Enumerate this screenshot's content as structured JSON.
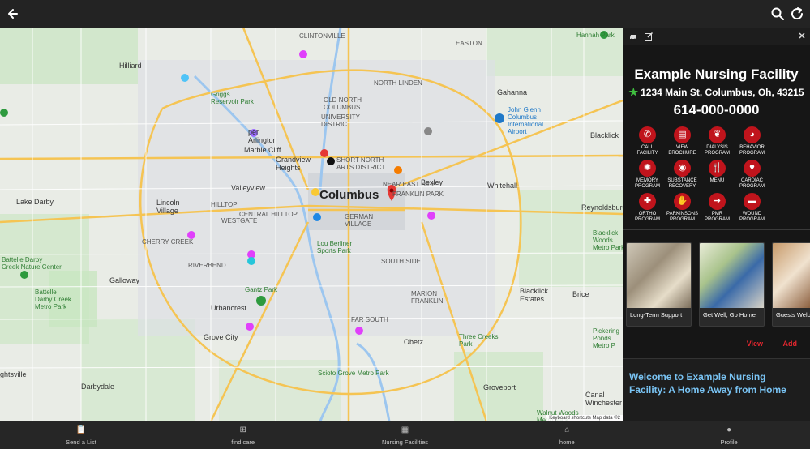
{
  "topbar": {
    "back_icon": "back-arrow-icon",
    "search_icon": "search-icon",
    "refresh_icon": "refresh-icon"
  },
  "map": {
    "labels": {
      "columbus": "Columbus",
      "hilliard": "Hilliard",
      "lake_darby": "Lake Darby",
      "galloway": "Galloway",
      "urbancrest": "Urbancrest",
      "grove_city": "Grove City",
      "darbydale": "Darbydale",
      "valleyview": "Valleyview",
      "lincoln_village": "Lincoln\nVillage",
      "marble_cliff": "Marble Cliff",
      "grandview": "Grandview\nHeights",
      "upper_arlington": "per\nArlington",
      "bexley": "Bexley",
      "whitehall": "Whitehall",
      "reynoldsburg": "Reynoldsburg",
      "blacklick": "Blacklick",
      "gahanna": "Gahanna",
      "obetz": "Obetz",
      "groveport": "Groveport",
      "brice": "Brice",
      "canal_winchester": "Canal\nWinchester",
      "blacklick_estates": "Blacklick\nEstates",
      "clintonville": "CLINTONVILLE",
      "easton": "EASTON",
      "north_linden": "NORTH LINDEN",
      "old_north": "OLD NORTH\nCOLUMBUS",
      "university": "UNIVERSITY\nDISTRICT",
      "short_north": "SHORT NORTH\nARTS DISTRICT",
      "near_east": "NEAR EAST SIDE",
      "franklin_park": "FRANKLIN PARK",
      "german_village": "GERMAN\nVILLAGE",
      "hilltop": "HILLTOP",
      "westgate": "WESTGATE",
      "central_hilltop": "CENTRAL HILLTOP",
      "cherry_creek": "CHERRY CREEK",
      "riverbend": "RIVERBEND",
      "far_south": "FAR SOUTH",
      "marion_franklin": "MARION\nFRANKLIN",
      "south_side": "SOUTH SIDE",
      "hannah_park": "Hannah Park",
      "john_glenn": "John Glenn\nColumbus\nInternational\nAirport",
      "griggs": "Griggs\nReservoir Park",
      "lou_berliner": "Lou Berliner\nSports Park",
      "gantz_park": "Gantz Park",
      "scioto_grove": "Scioto Grove Metro Park",
      "three_creeks": "Three Creeks\nPark",
      "battelle_nature": "Battelle Darby\nCreek Nature Center",
      "battelle_metro": "Battelle\nDarby Creek\nMetro Park",
      "blacklick_woods": "Blacklick\nWoods\nMetro Park",
      "walnut_woods": "Walnut Woods\nMetro Park",
      "pickerington": "Pickering\nPonds\nMetro P",
      "sightsville": "ghtsville"
    },
    "attribution": "Keyboard shortcuts   Map data ©2"
  },
  "panel": {
    "car_icon": "car-icon",
    "edit_icon": "edit-icon",
    "close_icon": "close-icon",
    "facility_name": "Example Nursing Facility",
    "address": "1234 Main St, Columbus, Oh, 43215",
    "phone": "614-000-0000",
    "actions": [
      {
        "label": "CALL\nFACILITY",
        "icon": "phone-icon"
      },
      {
        "label": "VIEW\nBROCHURE",
        "icon": "brochure-icon"
      },
      {
        "label": "DIALYSIS\nPROGRAM",
        "icon": "kidney-icon"
      },
      {
        "label": "BEHAVIOR\nPROGRAM",
        "icon": "head-icon"
      },
      {
        "label": "MEMORY\nPROGRAM",
        "icon": "memory-icon"
      },
      {
        "label": "SUBSTANCE\nRECOVERY",
        "icon": "recovery-icon"
      },
      {
        "label": "MENU",
        "icon": "utensils-icon"
      },
      {
        "label": "CARDIAC\nPROGRAM",
        "icon": "heart-icon"
      },
      {
        "label": "ORTHO\nPROGRAM",
        "icon": "bone-icon"
      },
      {
        "label": "PARKINSONS\nPROGRAM",
        "icon": "hand-icon"
      },
      {
        "label": "PMR\nPROGRAM",
        "icon": "walking-icon"
      },
      {
        "label": "WOUND\nPROGRAM",
        "icon": "bandage-icon"
      }
    ],
    "cards": [
      {
        "caption": "Long-Term Support"
      },
      {
        "caption": "Get Well, Go Home"
      },
      {
        "caption": "Guests Welc"
      }
    ],
    "view_label": "View",
    "add_label": "Add",
    "welcome_title": "Welcome to Example Nursing Facility: A Home Away from Home"
  },
  "bottom_nav": [
    {
      "label": "Send a List",
      "icon": "clipboard-icon"
    },
    {
      "label": "find care",
      "icon": "medkit-icon"
    },
    {
      "label": "Nursing Facilities",
      "icon": "facility-icon"
    },
    {
      "label": "home",
      "icon": "home-icon"
    },
    {
      "label": "Profile",
      "icon": "user-icon"
    }
  ],
  "colors": {
    "accent_red": "#c0141c",
    "link_red": "#e0262e",
    "welcome_blue": "#79c3f3",
    "star_green": "#3fbf3f"
  }
}
